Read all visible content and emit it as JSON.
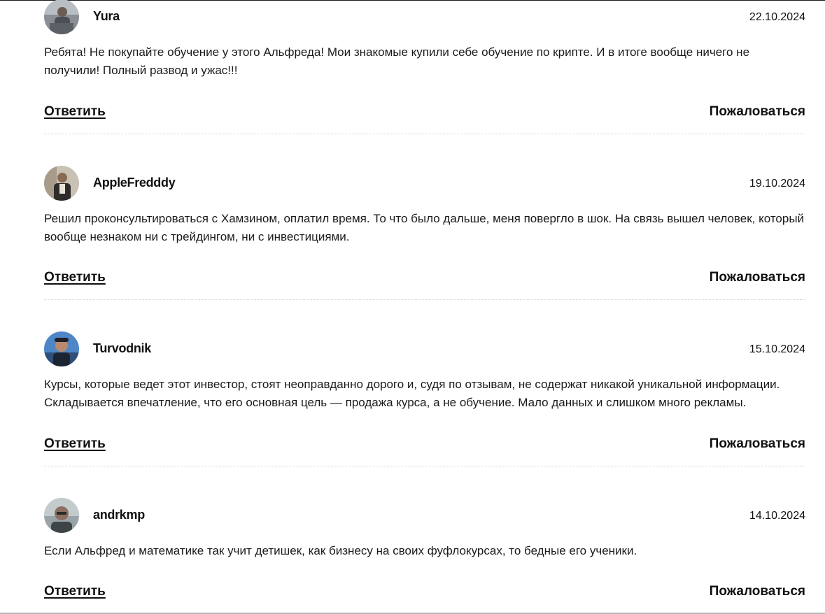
{
  "comments": [
    {
      "author": "Yura",
      "date": "22.10.2024",
      "text": "Ребята! Не покупайте обучение у этого Альфреда! Мои знакомые купили себе обучение по крипте. И в итоге вообще ничего не получили! Полный развод и ужас!!!",
      "reply_label": "Ответить",
      "report_label": "Пожаловаться"
    },
    {
      "author": "AppleFredddy",
      "date": "19.10.2024",
      "text": "Решил проконсультироваться с Хамзином, оплатил время. То что было дальше, меня повергло в шок. На связь вышел человек, который вообще незнаком ни с трейдингом, ни с инвестициями.",
      "reply_label": "Ответить",
      "report_label": "Пожаловаться"
    },
    {
      "author": "Turvodnik",
      "date": "15.10.2024",
      "text": "Курсы, которые ведет этот инвестор, стоят неоправданно дорого и, судя по отзывам, не содержат никакой уникальной информации. Складывается впечатление, что его основная цель — продажа курса, а не обучение. Мало данных и слишком много рекламы.",
      "reply_label": "Ответить",
      "report_label": "Пожаловаться"
    },
    {
      "author": "andrkmp",
      "date": "14.10.2024",
      "text": "Если Альфред и математике так учит детишек, как бизнесу на своих фуфлокурсах, то бедные его ученики.",
      "reply_label": "Ответить",
      "report_label": "Пожаловаться"
    }
  ]
}
